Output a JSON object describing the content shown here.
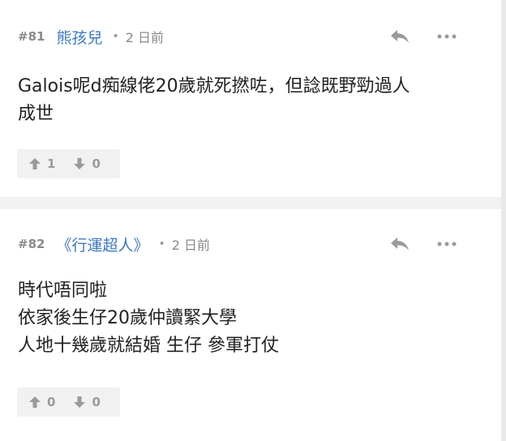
{
  "posts": [
    {
      "number": "#81",
      "author": "熊孩兒",
      "separator": "•",
      "time": "2 日前",
      "content": "Galois呢d痴線佬20歲就死撚咗，但諗既野勁過人\n成世",
      "upvotes": "1",
      "downvotes": "0"
    },
    {
      "number": "#82",
      "author": "《行運超人》",
      "separator": "•",
      "time": "2 日前",
      "content": "時代唔同啦\n依家後生仔20歲仲讀緊大學\n人地十幾歲就結婚 生仔 參軍打仗",
      "upvotes": "0",
      "downvotes": "0"
    }
  ],
  "icons": {
    "reply": "reply-icon",
    "more": "more-icon",
    "upvote": "arrow-up-icon",
    "downvote": "arrow-down-icon"
  },
  "colors": {
    "author": "#3b78c4",
    "muted": "#8a8a8a",
    "icon": "#9a9a9a",
    "background": "#f2f2f2",
    "vote_bar": "#f1f1f1"
  }
}
